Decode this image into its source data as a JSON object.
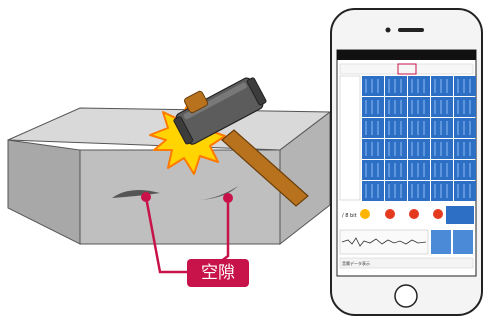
{
  "annotation": {
    "void_label": "空隙"
  },
  "phone": {
    "app_value_label": "/ 8 bit",
    "bottom_label": "音響データ表示"
  },
  "colors": {
    "block_top": "#d9d9d9",
    "block_front": "#bdbdbd",
    "block_side": "#a6a6a6",
    "hammer_head": "#5a5a5a",
    "hammer_handle": "#b8721d",
    "impact_fill": "#ffd400",
    "impact_stroke": "#ff7a00",
    "void_accent": "#c8134a",
    "spectrogram_blue": "#2e6fc6",
    "phone_frame": "#222222"
  },
  "icons": [
    "hammer-icon",
    "impact-burst-icon",
    "phone-icon",
    "home-button-icon"
  ]
}
